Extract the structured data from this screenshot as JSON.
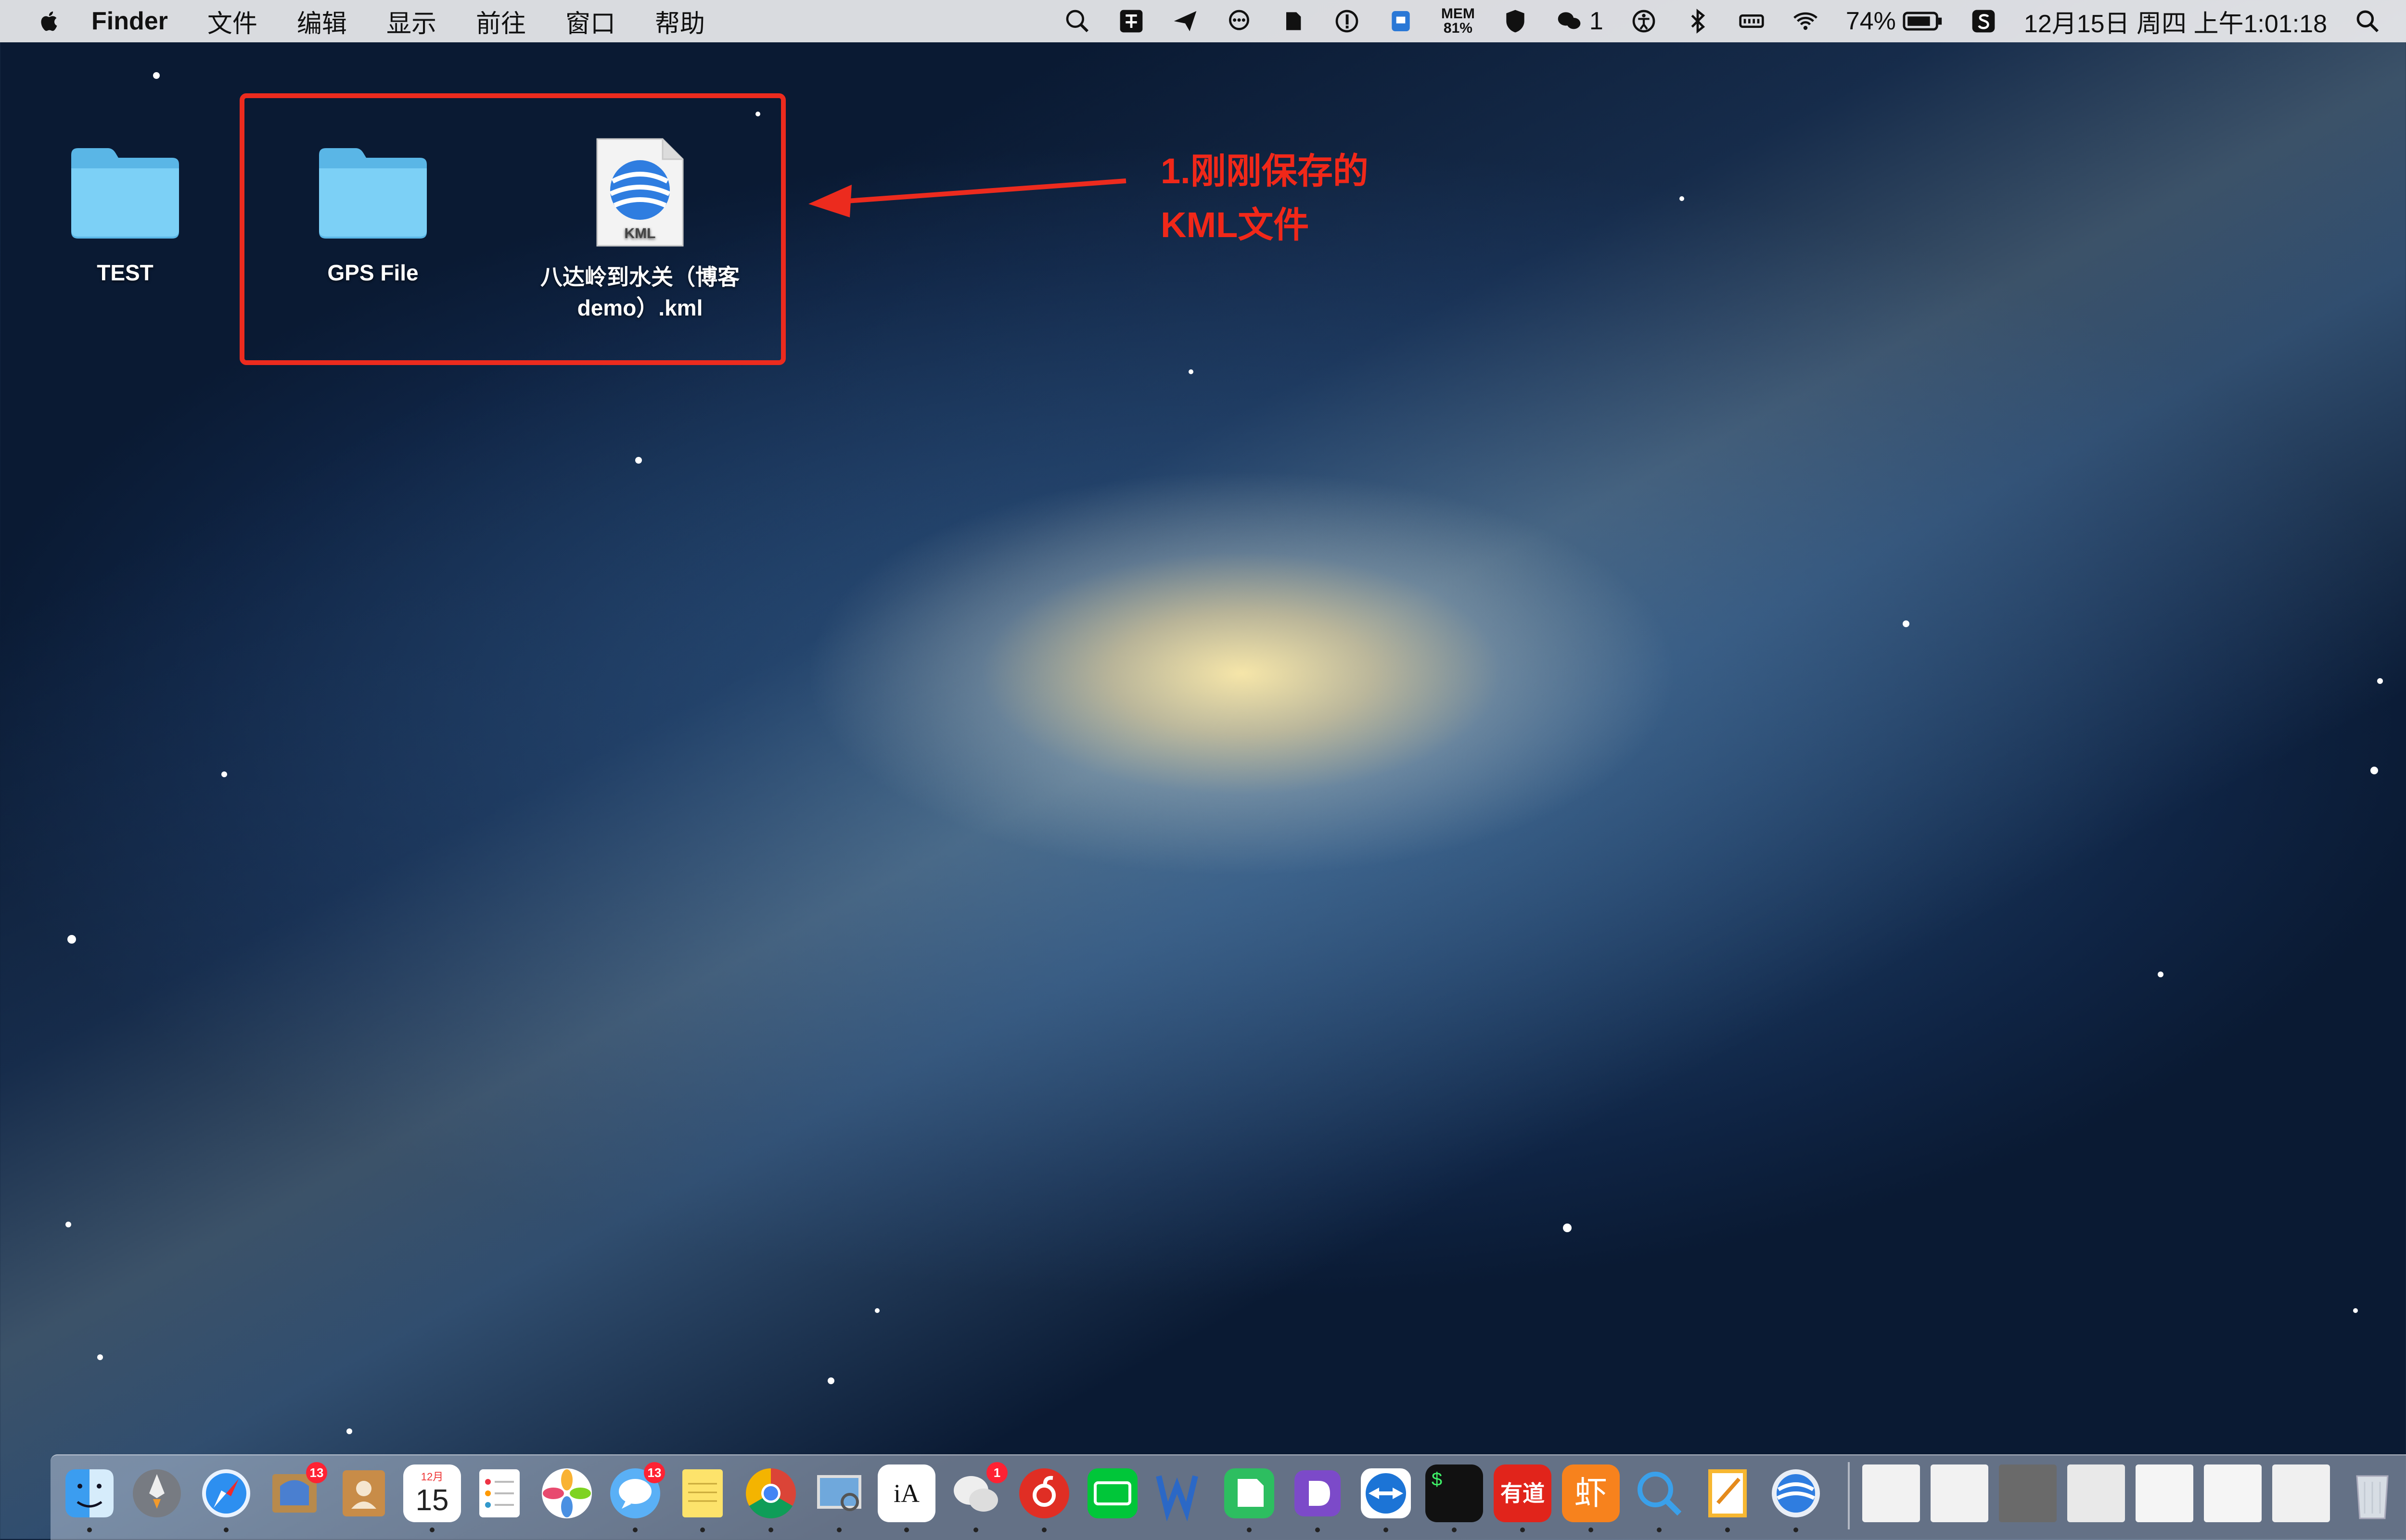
{
  "menubar": {
    "app_name": "Finder",
    "menus": [
      "文件",
      "编辑",
      "显示",
      "前往",
      "窗口",
      "帮助"
    ],
    "mem_label": "MEM",
    "mem_value": "81%",
    "wechat_count": "1",
    "battery": "74%",
    "clock": "12月15日 周四 上午1:01:18"
  },
  "desktop": {
    "icons": [
      {
        "label": "TEST"
      },
      {
        "label": "GPS File"
      },
      {
        "label_line1": "八达岭到水关（博客",
        "label_line2": "demo）.kml",
        "badge": "KML"
      }
    ]
  },
  "annotation": {
    "line1": "1.刚刚保存的",
    "line2": "KML文件"
  },
  "dock": {
    "badges": {
      "mail": "13",
      "messages": "13",
      "wechat": "1"
    },
    "calendar": {
      "month": "12月",
      "day": "15"
    },
    "youdao_text": "有道",
    "xiami_text": "虾",
    "ia_text": "iA",
    "terminal_text": "$"
  },
  "colors": {
    "annotation_red": "#ec2b1e",
    "folder_blue": "#6cc4f0"
  }
}
